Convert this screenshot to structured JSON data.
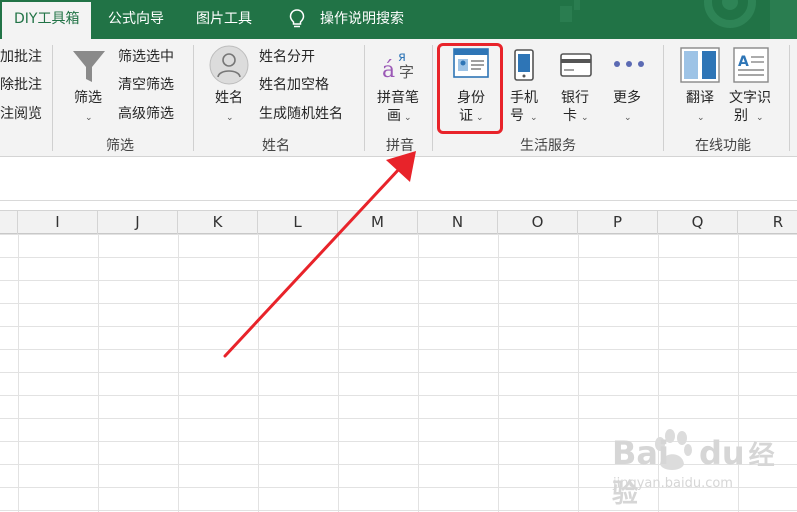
{
  "tabs": {
    "active": "DIY工具箱",
    "formula_wizard": "公式向导",
    "image_tools": "图片工具",
    "search_help": "操作说明搜索"
  },
  "ribbon": {
    "comments": {
      "add": "加批注",
      "delete": "除批注",
      "read": "注阅览"
    },
    "filter": {
      "button": "筛选",
      "select_filter": "筛选选中",
      "clear_filter": "清空筛选",
      "advanced_filter": "高级筛选",
      "group_label": "筛选"
    },
    "name": {
      "button": "姓名",
      "split": "姓名分开",
      "add_space": "姓名加空格",
      "random": "生成随机姓名",
      "group_label": "姓名"
    },
    "pinyin": {
      "button_line1": "拼音笔",
      "button_line2": "画",
      "group_label": "拼音"
    },
    "life_services": {
      "id_card_line1": "身份",
      "id_card_line2": "证",
      "phone_line1": "手机",
      "phone_line2": "号",
      "bank_line1": "银行",
      "bank_line2": "卡",
      "more": "更多",
      "group_label": "生活服务"
    },
    "online": {
      "translate": "翻译",
      "ocr_line1": "文字识",
      "ocr_line2": "别",
      "group_label": "在线功能"
    }
  },
  "columns": [
    "I",
    "J",
    "K",
    "L",
    "M",
    "N",
    "O",
    "P",
    "Q",
    "R"
  ],
  "watermark": {
    "brand": "Bai",
    "brand2": "du",
    "brand_cn": "经验",
    "url": "jingyan.baidu.com"
  },
  "colors": {
    "excel_green": "#217346",
    "highlight_red": "#e8232a"
  }
}
